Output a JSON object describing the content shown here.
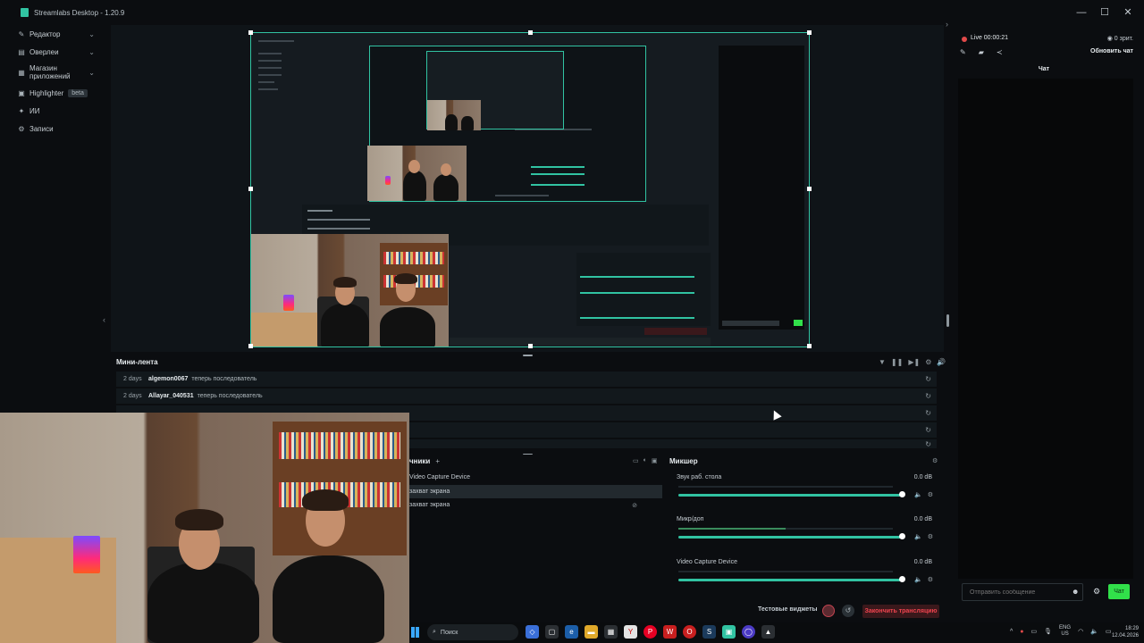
{
  "window": {
    "title": "Streamlabs Desktop - 1.20.9",
    "controls": [
      "—",
      "☐",
      "✕"
    ]
  },
  "sidebar": {
    "items": [
      {
        "label": "Редактор",
        "icon": "brush-icon",
        "chevron": "⌄"
      },
      {
        "label": "Оверлеи",
        "icon": "layers-icon",
        "chevron": "⌄"
      },
      {
        "label": "Магазин приложений",
        "icon": "store-icon",
        "chevron": "⌄"
      },
      {
        "label": "Highlighter",
        "icon": "highlighter-icon",
        "badge": "beta"
      },
      {
        "label": "ИИ",
        "icon": "sparkle-icon"
      },
      {
        "label": "Записи",
        "icon": "gear-icon"
      }
    ]
  },
  "mini_feed": {
    "title": "Мини-лента",
    "controls": [
      "▼",
      "❚❚",
      "▶❚",
      "⚙",
      "🔊"
    ],
    "rows": [
      {
        "ago": "2 days",
        "user": "algemon0067",
        "message": "теперь последователь"
      },
      {
        "ago": "2 days",
        "user": "Allayar_040531",
        "message": "теперь последователь"
      }
    ]
  },
  "sources": {
    "title": "чники",
    "add": "+",
    "items": [
      {
        "name": "Video Capture Device"
      },
      {
        "name": "захват экрана"
      },
      {
        "name": "захват экрана"
      }
    ]
  },
  "mixer": {
    "title": "Микшер",
    "channels": [
      {
        "name": "Звук раб. стола",
        "db": "0.0 dB",
        "level": 0.0
      },
      {
        "name": "Микр/доп",
        "db": "0.0 dB",
        "level": 0.5
      },
      {
        "name": "Video Capture Device",
        "db": "0.0 dB",
        "level": 0.0
      }
    ]
  },
  "footer": {
    "test_widgets": "Тестовые виджеты",
    "stop_stream": "Закончить трансляцию"
  },
  "taskbar": {
    "search": "Поиск",
    "lang_top": "ENG",
    "lang_bottom": "US",
    "time": "18:29",
    "date": "12.04.2026"
  },
  "chat": {
    "live": "Live 00:00:21",
    "viewers": "0 зрит.",
    "refresh": "Обновить чат",
    "tab": "Чат",
    "input_placeholder": "Отправить сообщение",
    "send": "Чат"
  },
  "colors": {
    "accent": "#31c3a2",
    "live": "#e24a4a",
    "send": "#31e04a",
    "stop": "#f0444f"
  }
}
